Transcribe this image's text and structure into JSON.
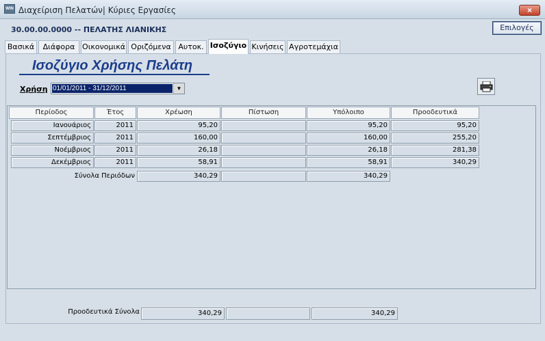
{
  "window": {
    "title": "Διαχείριση Πελατών| Κύριες Εργασίες",
    "icon": "app-icon",
    "close_label": "×"
  },
  "header": {
    "customer": "30.00.00.0000 -- ΠΕΛΑΤΗΣ ΛΙΑΝΙΚΗΣ",
    "options_label": "Επιλογές"
  },
  "tabs": [
    {
      "label": "Βασικά"
    },
    {
      "label": "Διάφορα"
    },
    {
      "label": "Οικονομικά"
    },
    {
      "label": "Οριζόμενα"
    },
    {
      "label": "Αυτοκ."
    },
    {
      "label": "Ισοζύγιο"
    },
    {
      "label": "Κινήσεις"
    },
    {
      "label": "Αγροτεμάχια"
    }
  ],
  "section": {
    "title": "Ισοζύγιο Χρήσης Πελάτη",
    "year_label": "Χρήση",
    "year_value": "01/01/2011 - 31/12/2011",
    "print_icon": "printer-icon"
  },
  "table": {
    "headers": [
      "Περίοδος",
      "Έτος",
      "Χρέωση",
      "Πίστωση",
      "Υπόλοιπο",
      "Προοδευτικά"
    ],
    "rows": [
      {
        "period": "Ιανουάριος",
        "year": "2011",
        "debit": "95,20",
        "credit": "",
        "balance": "95,20",
        "progressive": "95,20"
      },
      {
        "period": "Σεπτέμβριος",
        "year": "2011",
        "debit": "160,00",
        "credit": "",
        "balance": "160,00",
        "progressive": "255,20"
      },
      {
        "period": "Νοέμβριος",
        "year": "2011",
        "debit": "26,18",
        "credit": "",
        "balance": "26,18",
        "progressive": "281,38"
      },
      {
        "period": "Δεκέμβριος",
        "year": "2011",
        "debit": "58,91",
        "credit": "",
        "balance": "58,91",
        "progressive": "340,29"
      }
    ],
    "totals": {
      "label": "Σύνολα Περιόδων",
      "debit": "340,29",
      "credit": "",
      "balance": "340,29"
    }
  },
  "footer": {
    "label": "Προοδευτικά Σύνολα",
    "debit": "340,29",
    "credit": "",
    "balance": "340,29"
  }
}
